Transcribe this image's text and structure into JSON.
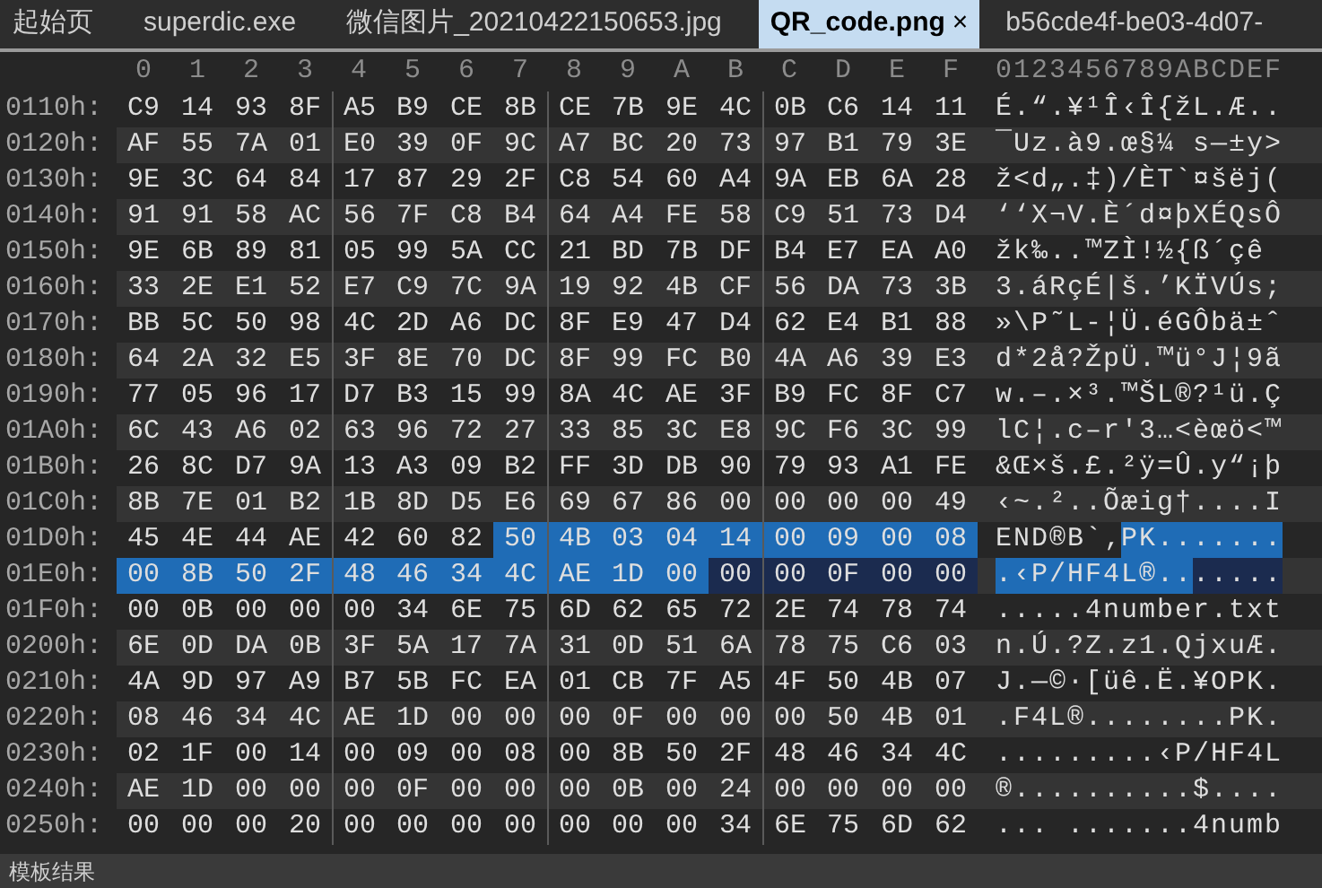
{
  "tabs": [
    {
      "label": "起始页",
      "selected": false
    },
    {
      "label": "superdic.exe",
      "selected": false
    },
    {
      "label": "微信图片_20210422150653.jpg",
      "selected": false
    },
    {
      "label": "QR_code.png",
      "selected": true,
      "close": "×"
    },
    {
      "label": "b56cde4f-be03-4d07-",
      "selected": false
    }
  ],
  "column_headers": [
    "0",
    "1",
    "2",
    "3",
    "4",
    "5",
    "6",
    "7",
    "8",
    "9",
    "A",
    "B",
    "C",
    "D",
    "E",
    "F"
  ],
  "ascii_header": "0123456789ABCDEF",
  "rows": [
    {
      "offset": "0110h:",
      "hex": [
        {
          "selected": false,
          "marked": false,
          "bytes": [
            "C9",
            "14",
            "93",
            "8F",
            "A5",
            "B9",
            "CE",
            "8B",
            "CE",
            "7B",
            "9E",
            "4C",
            "0B",
            "C6",
            "14",
            "11"
          ]
        }
      ],
      "ascii": [
        {
          "selected": false,
          "marked": false,
          "text": "É.“.¥¹Î‹Î{žL.Æ.."
        }
      ]
    },
    {
      "offset": "0120h:",
      "hex": [
        {
          "selected": false,
          "marked": false,
          "bytes": [
            "AF",
            "55",
            "7A",
            "01",
            "E0",
            "39",
            "0F",
            "9C",
            "A7",
            "BC",
            "20",
            "73",
            "97",
            "B1",
            "79",
            "3E"
          ]
        }
      ],
      "ascii": [
        {
          "selected": false,
          "marked": false,
          "text": "¯Uz.à9.œ§¼ s—±y>"
        }
      ]
    },
    {
      "offset": "0130h:",
      "hex": [
        {
          "selected": false,
          "marked": false,
          "bytes": [
            "9E",
            "3C",
            "64",
            "84",
            "17",
            "87",
            "29",
            "2F",
            "C8",
            "54",
            "60",
            "A4",
            "9A",
            "EB",
            "6A",
            "28"
          ]
        }
      ],
      "ascii": [
        {
          "selected": false,
          "marked": false,
          "text": "ž<d„.‡)/ÈT`¤šëj("
        }
      ]
    },
    {
      "offset": "0140h:",
      "hex": [
        {
          "selected": false,
          "marked": false,
          "bytes": [
            "91",
            "91",
            "58",
            "AC",
            "56",
            "7F",
            "C8",
            "B4",
            "64",
            "A4",
            "FE",
            "58",
            "C9",
            "51",
            "73",
            "D4"
          ]
        }
      ],
      "ascii": [
        {
          "selected": false,
          "marked": false,
          "text": "‘‘X¬V.È´d¤þXÉQsÔ"
        }
      ]
    },
    {
      "offset": "0150h:",
      "hex": [
        {
          "selected": false,
          "marked": false,
          "bytes": [
            "9E",
            "6B",
            "89",
            "81",
            "05",
            "99",
            "5A",
            "CC",
            "21",
            "BD",
            "7B",
            "DF",
            "B4",
            "E7",
            "EA",
            "A0"
          ]
        }
      ],
      "ascii": [
        {
          "selected": false,
          "marked": false,
          "text": "žk‰..™ZÌ!½{ß´çê"
        }
      ]
    },
    {
      "offset": "0160h:",
      "hex": [
        {
          "selected": false,
          "marked": false,
          "bytes": [
            "33",
            "2E",
            "E1",
            "52",
            "E7",
            "C9",
            "7C",
            "9A",
            "19",
            "92",
            "4B",
            "CF",
            "56",
            "DA",
            "73",
            "3B"
          ]
        }
      ],
      "ascii": [
        {
          "selected": false,
          "marked": false,
          "text": "3.áRçÉ|š.’KÏVÚs;"
        }
      ]
    },
    {
      "offset": "0170h:",
      "hex": [
        {
          "selected": false,
          "marked": false,
          "bytes": [
            "BB",
            "5C",
            "50",
            "98",
            "4C",
            "2D",
            "A6",
            "DC",
            "8F",
            "E9",
            "47",
            "D4",
            "62",
            "E4",
            "B1",
            "88"
          ]
        }
      ],
      "ascii": [
        {
          "selected": false,
          "marked": false,
          "text": "»\\P˜L-¦Ü.éGÔbä±ˆ"
        }
      ]
    },
    {
      "offset": "0180h:",
      "hex": [
        {
          "selected": false,
          "marked": false,
          "bytes": [
            "64",
            "2A",
            "32",
            "E5",
            "3F",
            "8E",
            "70",
            "DC",
            "8F",
            "99",
            "FC",
            "B0",
            "4A",
            "A6",
            "39",
            "E3"
          ]
        }
      ],
      "ascii": [
        {
          "selected": false,
          "marked": false,
          "text": "d*2å?ŽpÜ.™ü°J¦9ã"
        }
      ]
    },
    {
      "offset": "0190h:",
      "hex": [
        {
          "selected": false,
          "marked": false,
          "bytes": [
            "77",
            "05",
            "96",
            "17",
            "D7",
            "B3",
            "15",
            "99",
            "8A",
            "4C",
            "AE",
            "3F",
            "B9",
            "FC",
            "8F",
            "C7"
          ]
        }
      ],
      "ascii": [
        {
          "selected": false,
          "marked": false,
          "text": "w.–.×³.™ŠL®?¹ü.Ç"
        }
      ]
    },
    {
      "offset": "01A0h:",
      "hex": [
        {
          "selected": false,
          "marked": false,
          "bytes": [
            "6C",
            "43",
            "A6",
            "02",
            "63",
            "96",
            "72",
            "27",
            "33",
            "85",
            "3C",
            "E8",
            "9C",
            "F6",
            "3C",
            "99"
          ]
        }
      ],
      "ascii": [
        {
          "selected": false,
          "marked": false,
          "text": "lC¦.c–r'3…<èœö<™"
        }
      ]
    },
    {
      "offset": "01B0h:",
      "hex": [
        {
          "selected": false,
          "marked": false,
          "bytes": [
            "26",
            "8C",
            "D7",
            "9A",
            "13",
            "A3",
            "09",
            "B2",
            "FF",
            "3D",
            "DB",
            "90",
            "79",
            "93",
            "A1",
            "FE"
          ]
        }
      ],
      "ascii": [
        {
          "selected": false,
          "marked": false,
          "text": "&Œ×š.£.²ÿ=Û.y“¡þ"
        }
      ]
    },
    {
      "offset": "01C0h:",
      "hex": [
        {
          "selected": false,
          "marked": false,
          "bytes": [
            "8B",
            "7E",
            "01",
            "B2",
            "1B",
            "8D",
            "D5",
            "E6",
            "69",
            "67",
            "86",
            "00",
            "00",
            "00",
            "00",
            "49"
          ]
        }
      ],
      "ascii": [
        {
          "selected": false,
          "marked": false,
          "text": "‹~.²..Õæig†....I"
        }
      ]
    },
    {
      "offset": "01D0h:",
      "hex": [
        {
          "selected": false,
          "marked": false,
          "bytes": [
            "45",
            "4E",
            "44",
            "AE",
            "42",
            "60",
            "82"
          ]
        },
        {
          "selected": true,
          "marked": false,
          "bytes": [
            "50",
            "4B",
            "03",
            "04",
            "14",
            "00",
            "09",
            "00",
            "08"
          ]
        }
      ],
      "ascii": [
        {
          "selected": false,
          "marked": false,
          "text": "END®B`‚"
        },
        {
          "selected": true,
          "marked": false,
          "text": "PK......."
        }
      ]
    },
    {
      "offset": "01E0h:",
      "hex": [
        {
          "selected": true,
          "marked": false,
          "bytes": [
            "00",
            "8B",
            "50",
            "2F",
            "48",
            "46",
            "34",
            "4C",
            "AE",
            "1D",
            "00"
          ]
        },
        {
          "selected": false,
          "marked": true,
          "bytes": [
            "00",
            "00",
            "0F",
            "00",
            "00"
          ]
        }
      ],
      "ascii": [
        {
          "selected": true,
          "marked": false,
          "text": ".‹P/HF4L®.."
        },
        {
          "selected": false,
          "marked": true,
          "text": "....."
        }
      ]
    },
    {
      "offset": "01F0h:",
      "hex": [
        {
          "selected": false,
          "marked": false,
          "bytes": [
            "00",
            "0B",
            "00",
            "00",
            "00",
            "34",
            "6E",
            "75",
            "6D",
            "62",
            "65",
            "72",
            "2E",
            "74",
            "78",
            "74"
          ]
        }
      ],
      "ascii": [
        {
          "selected": false,
          "marked": false,
          "text": ".....4number.txt"
        }
      ]
    },
    {
      "offset": "0200h:",
      "hex": [
        {
          "selected": false,
          "marked": false,
          "bytes": [
            "6E",
            "0D",
            "DA",
            "0B",
            "3F",
            "5A",
            "17",
            "7A",
            "31",
            "0D",
            "51",
            "6A",
            "78",
            "75",
            "C6",
            "03"
          ]
        }
      ],
      "ascii": [
        {
          "selected": false,
          "marked": false,
          "text": "n.Ú.?Z.z1.QjxuÆ."
        }
      ]
    },
    {
      "offset": "0210h:",
      "hex": [
        {
          "selected": false,
          "marked": false,
          "bytes": [
            "4A",
            "9D",
            "97",
            "A9",
            "B7",
            "5B",
            "FC",
            "EA",
            "01",
            "CB",
            "7F",
            "A5",
            "4F",
            "50",
            "4B",
            "07"
          ]
        }
      ],
      "ascii": [
        {
          "selected": false,
          "marked": false,
          "text": "J.—©·[üê.Ë.¥OPK."
        }
      ]
    },
    {
      "offset": "0220h:",
      "hex": [
        {
          "selected": false,
          "marked": false,
          "bytes": [
            "08",
            "46",
            "34",
            "4C",
            "AE",
            "1D",
            "00",
            "00",
            "00",
            "0F",
            "00",
            "00",
            "00",
            "50",
            "4B",
            "01"
          ]
        }
      ],
      "ascii": [
        {
          "selected": false,
          "marked": false,
          "text": ".F4L®........PK."
        }
      ]
    },
    {
      "offset": "0230h:",
      "hex": [
        {
          "selected": false,
          "marked": false,
          "bytes": [
            "02",
            "1F",
            "00",
            "14",
            "00",
            "09",
            "00",
            "08",
            "00",
            "8B",
            "50",
            "2F",
            "48",
            "46",
            "34",
            "4C"
          ]
        }
      ],
      "ascii": [
        {
          "selected": false,
          "marked": false,
          "text": ".........‹P/HF4L"
        }
      ]
    },
    {
      "offset": "0240h:",
      "hex": [
        {
          "selected": false,
          "marked": false,
          "bytes": [
            "AE",
            "1D",
            "00",
            "00",
            "00",
            "0F",
            "00",
            "00",
            "00",
            "0B",
            "00",
            "24",
            "00",
            "00",
            "00",
            "00"
          ]
        }
      ],
      "ascii": [
        {
          "selected": false,
          "marked": false,
          "text": "®..........$...."
        }
      ]
    },
    {
      "offset": "0250h:",
      "hex": [
        {
          "selected": false,
          "marked": false,
          "bytes": [
            "00",
            "00",
            "00",
            "20",
            "00",
            "00",
            "00",
            "00",
            "00",
            "00",
            "00",
            "34",
            "6E",
            "75",
            "6D",
            "62"
          ]
        }
      ],
      "ascii": [
        {
          "selected": false,
          "marked": false,
          "text": "... .......4numb"
        }
      ]
    }
  ],
  "bottom_panel": {
    "title": "模板结果"
  }
}
